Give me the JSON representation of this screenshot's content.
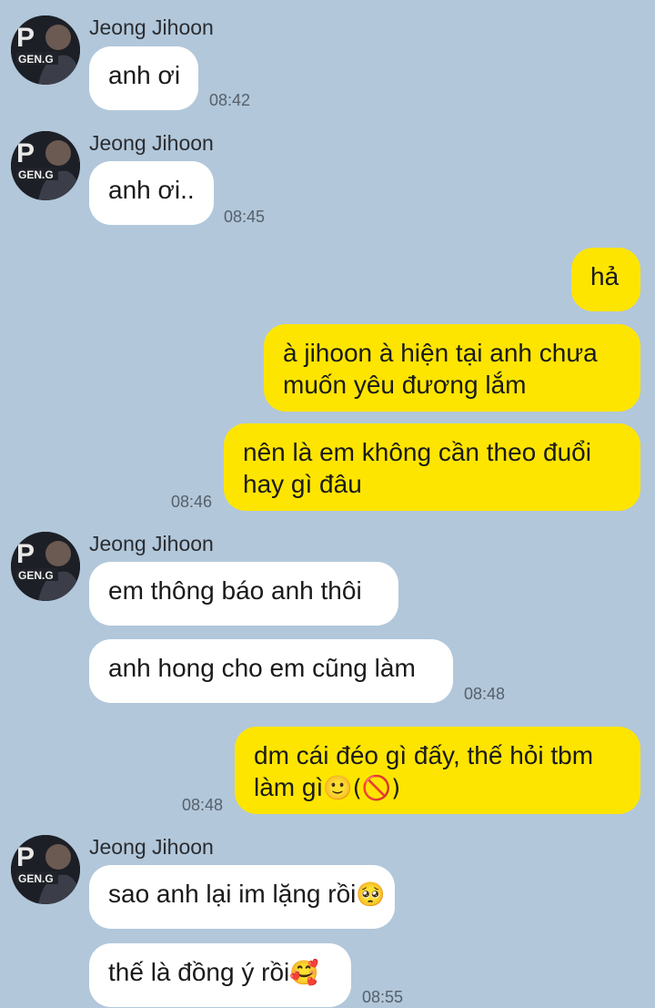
{
  "contact": {
    "name": "Jeong Jihoon",
    "avatar_text": "GEN.G"
  },
  "messages": [
    {
      "sender": "Jeong Jihoon",
      "text": "anh ơi",
      "time": "08:42"
    },
    {
      "sender": "Jeong Jihoon",
      "text": "anh ơi..",
      "time": "08:45"
    },
    {
      "sender": "me",
      "text": "hả"
    },
    {
      "sender": "me",
      "line1": "à jihoon à hiện tại anh chưa",
      "line2": "muốn yêu đương lắm"
    },
    {
      "sender": "me",
      "line1": "nên là em không cần theo đuổi",
      "line2": "hay gì đâu",
      "time": "08:46"
    },
    {
      "sender": "Jeong Jihoon",
      "text": "em thông báo anh thôi"
    },
    {
      "sender": "Jeong Jihoon",
      "text": "anh hong cho em cũng làm",
      "time": "08:48"
    },
    {
      "sender": "me",
      "line1": "dm cái đéo gì đấy, thế hỏi tbm",
      "line2": "làm gì",
      "emoji": "🙂(🚫)",
      "time": "08:48"
    },
    {
      "sender": "Jeong Jihoon",
      "text": "sao anh lại im lặng rồi",
      "emoji": "🥺"
    },
    {
      "sender": "Jeong Jihoon",
      "text": "thế là đồng ý rồi",
      "emoji": "🥰",
      "time": "08:55"
    }
  ],
  "colors": {
    "background": "#b2c7da",
    "incoming": "#ffffff",
    "outgoing": "#fee500"
  }
}
